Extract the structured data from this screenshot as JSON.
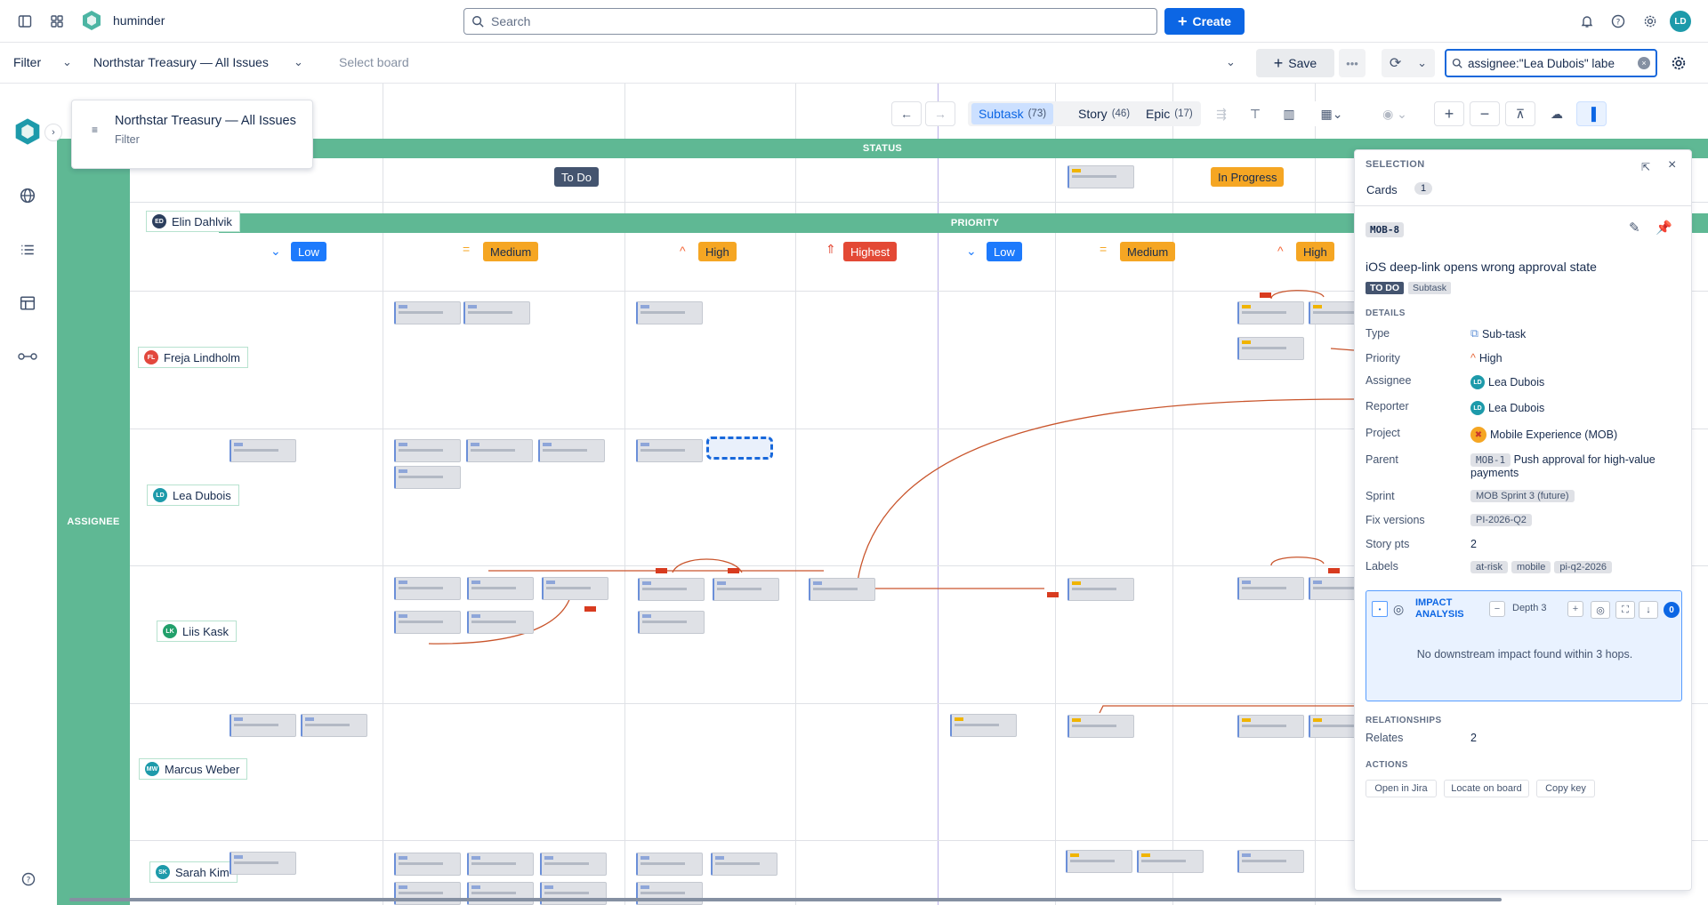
{
  "app": {
    "name": "huminder"
  },
  "search": {
    "placeholder": "Search"
  },
  "header": {
    "create_label": "Create",
    "avatar_initials": "LD"
  },
  "toolbar": {
    "filter_label": "Filter",
    "filter_value": "Northstar Treasury — All Issues",
    "board_placeholder": "Select board",
    "save_label": "Save",
    "jql_value": "assignee:\"Lea Dubois\" labe"
  },
  "filter_card": {
    "title": "Northstar Treasury — All Issues",
    "subtitle": "Filter"
  },
  "board_toolbar": {
    "tabs": [
      {
        "label": "Subtask",
        "count": "(73)"
      },
      {
        "label": "Story",
        "count": "(46)"
      },
      {
        "label": "Epic",
        "count": "(17)"
      }
    ]
  },
  "board": {
    "status_band": "STATUS",
    "priority_band": "PRIORITY",
    "assignee_band": "ASSIGNEE",
    "status_to_do": "To Do",
    "status_in_progress": "In Progress",
    "priorities": [
      "Low",
      "Medium",
      "High",
      "Highest",
      "Low",
      "Medium",
      "High"
    ],
    "rows": [
      {
        "name": "Elin Dahlvik",
        "initials": "ED",
        "color": "#2c3e5d"
      },
      {
        "name": "Freja Lindholm",
        "initials": "FL",
        "color": "#e2483d"
      },
      {
        "name": "Lea Dubois",
        "initials": "LD",
        "color": "#1d9aaa"
      },
      {
        "name": "Liis Kask",
        "initials": "LK",
        "color": "#22a06b"
      },
      {
        "name": "Marcus Weber",
        "initials": "MW",
        "color": "#1d9aaa"
      },
      {
        "name": "Sarah Kim",
        "initials": "SK",
        "color": "#1d9aaa"
      }
    ]
  },
  "panel": {
    "title": "SELECTION",
    "cards_label": "Cards",
    "cards_count": "1",
    "issue_key": "MOB-8",
    "issue_title": "iOS deep-link opens wrong approval state",
    "status": "TO DO",
    "type_chip": "Subtask",
    "details_label": "DETAILS",
    "details": {
      "type_label": "Type",
      "type_value": "Sub-task",
      "priority_label": "Priority",
      "priority_value": "High",
      "assignee_label": "Assignee",
      "assignee_value": "Lea Dubois",
      "reporter_label": "Reporter",
      "reporter_value": "Lea Dubois",
      "project_label": "Project",
      "project_value": "Mobile Experience (MOB)",
      "parent_label": "Parent",
      "parent_key": "MOB-1",
      "parent_value": "Push approval for high-value payments",
      "sprint_label": "Sprint",
      "sprint_value": "MOB Sprint 3 (future)",
      "fix_label": "Fix versions",
      "fix_value": "PI-2026-Q2",
      "points_label": "Story pts",
      "points_value": "2",
      "labels_label": "Labels",
      "labels": [
        "at-risk",
        "mobile",
        "pi-q2-2026"
      ]
    },
    "impact": {
      "title_line1": "IMPACT",
      "title_line2": "ANALYSIS",
      "depth": "Depth 3",
      "badge": "0",
      "message": "No downstream impact found within 3 hops."
    },
    "relationships_label": "RELATIONSHIPS",
    "relates_label": "Relates",
    "relates_value": "2",
    "actions_label": "ACTIONS",
    "actions": [
      "Open in Jira",
      "Locate on board",
      "Copy key"
    ]
  }
}
